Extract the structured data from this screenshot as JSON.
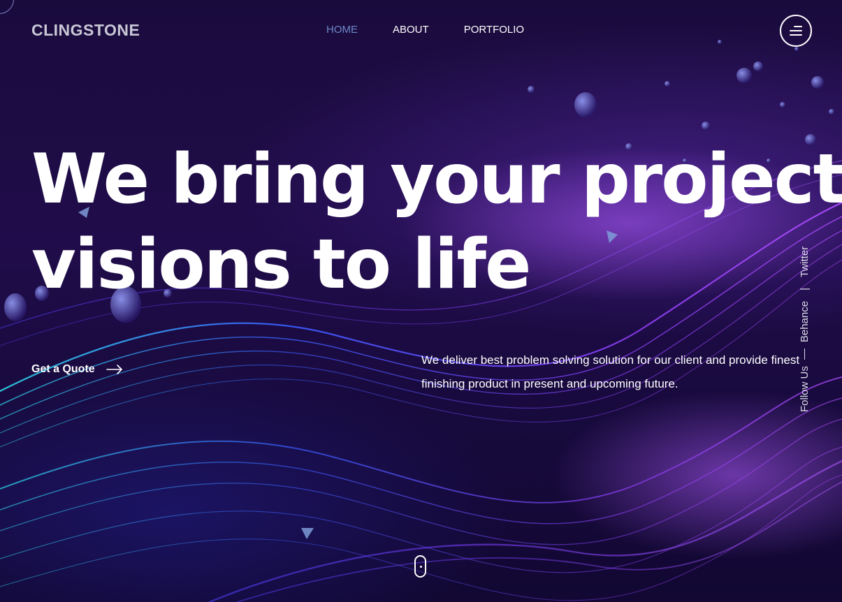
{
  "brand": {
    "logo_text": "CLINGSTONE"
  },
  "nav": {
    "items": [
      {
        "label": "HOME",
        "active": true
      },
      {
        "label": "ABOUT",
        "active": false
      },
      {
        "label": "PORTFOLIO",
        "active": false
      }
    ],
    "menu_icon": "hamburger-menu-icon"
  },
  "hero": {
    "headline_line1": "We bring your project",
    "headline_line2": "visions to life",
    "cta_label": "Get a Quote",
    "cta_icon": "arrow-right-icon",
    "tagline": "We deliver best problem solving solution for our client and provide finest finishing product in present and upcoming future."
  },
  "social": {
    "label": "Follow Us",
    "links": [
      "Behance",
      "Twitter"
    ],
    "separator": "|"
  },
  "scroll_indicator_icon": "mouse-scroll-icon",
  "colors": {
    "background": "#1a0b3d",
    "nav_active": "#6d88c9",
    "logo": "#c9c7d6",
    "text": "#ffffff",
    "wave_violet": "#8a3cf0",
    "wave_blue": "#3b5bff",
    "wave_cyan": "#2fd6e8",
    "triangle": "#7f9bd8"
  }
}
